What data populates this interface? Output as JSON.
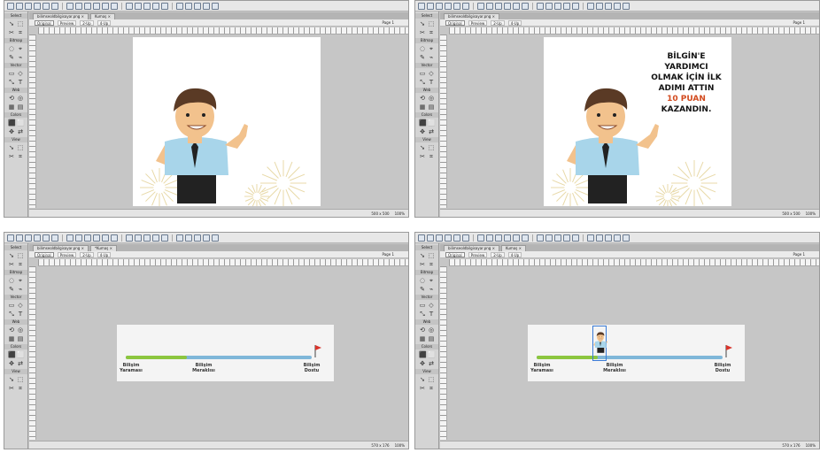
{
  "toolbar": {
    "buttons": 22
  },
  "tabs": {
    "p1": [
      "bilimseoldbilgisayar.png",
      "Kumaş"
    ],
    "p2": [
      "bilimseoldbilgisayar.png"
    ],
    "p3": [
      "bilimseoldbilgisayar.png",
      "*Kumaş"
    ],
    "p4": [
      "bilimseoldbilgisayar.png",
      "Kumaş"
    ]
  },
  "view": {
    "original": "Original",
    "preview": "Preview",
    "two_up": "2-Up",
    "four_up": "4-Up",
    "page": "Page 1"
  },
  "tools": {
    "select": "Select",
    "bitmap": "Bitmap",
    "vector": "Vector",
    "web": "Web",
    "colors": "Colors",
    "view": "View"
  },
  "status": {
    "size_top": "500 x 500",
    "size_bottom": "570 x 176",
    "zoom": "100%"
  },
  "message": {
    "line1": "BİLGİN'E",
    "line2": "YARDIMCI",
    "line3": "OLMAK İÇİN İLK",
    "line4": "ADIMI ATTIN",
    "line5": "10 PUAN",
    "line6": "KAZANDIN."
  },
  "timeline": {
    "start": [
      "Bilişim",
      "Yaraması"
    ],
    "middle": [
      "Bilişim",
      "Meraklısı"
    ],
    "end": [
      "Bilişim",
      "Dostu"
    ],
    "progress_p3": 0.33,
    "progress_p4": 0.33
  },
  "colors": {
    "accent": "#d24a1e",
    "green": "#8cc63f",
    "blue": "#7fb7d9"
  }
}
